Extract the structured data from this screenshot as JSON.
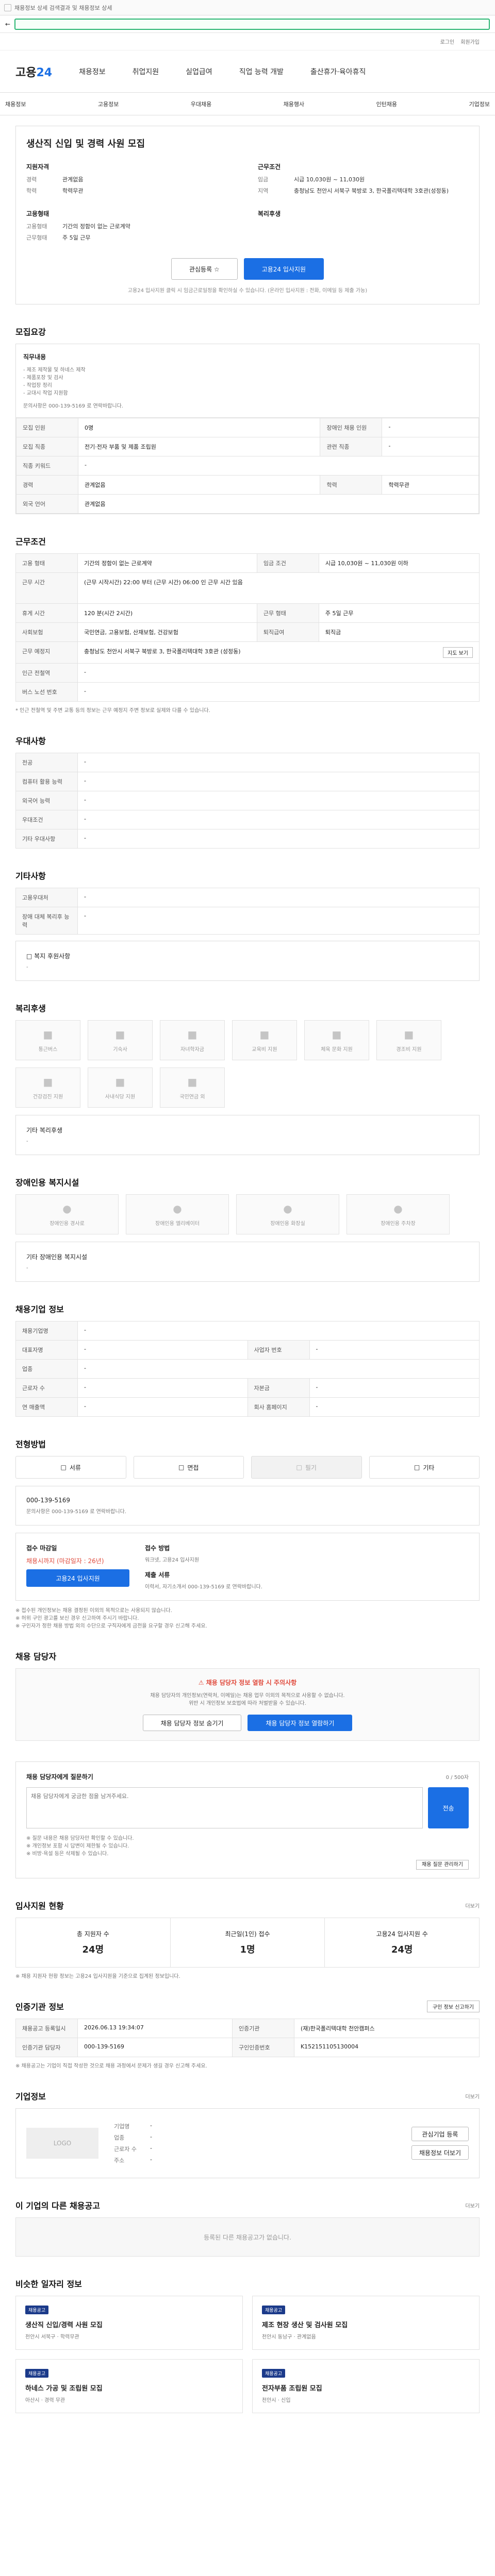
{
  "topbar": {
    "text": "채용정보 상세 검색결과 및 채용정보 상세"
  },
  "util": {
    "login": "로그인",
    "join": "회원가입"
  },
  "logo": {
    "main": "고용",
    "sub": "24"
  },
  "gnb": [
    "채용정보",
    "취업지원",
    "실업급여",
    "직업 능력 개발",
    "출산휴가·육아휴직"
  ],
  "subnav": [
    "채용정보",
    "고용정보",
    "우대채용",
    "채용행사",
    "인턴채용",
    "기업정보"
  ],
  "header": {
    "title": "생산직 신입 및 경력 사원 모집",
    "col1_title": "지원자격",
    "col1": [
      {
        "k": "경력",
        "v": "관계없음"
      },
      {
        "k": "학력",
        "v": "학력무관"
      }
    ],
    "col2_title": "근무조건",
    "col2": [
      {
        "k": "임금",
        "v": "시급 10,030원 ~ 11,030원"
      },
      {
        "k": "지역",
        "v": "충청남도 천안시 서북구 북방로 3, 한국폴리텍대학 3호관(성정동)"
      }
    ],
    "col3_title": "고용형태",
    "col3": [
      {
        "k": "고용형태",
        "v": "기간의 정함이 없는 근로계약"
      },
      {
        "k": "근무형태",
        "v": "주 5일 근무"
      }
    ],
    "col4_title": "복리후생",
    "col4": [],
    "interest": "관심등록 ☆",
    "apply": "고용24 입사지원",
    "note": "고용24 입사지원 클릭 시 임금근로일정을 확인하실 수 있습니다. (온라인 입사지원 : 전화, 이메일 등 제출 가능)"
  },
  "recruit": {
    "title": "모집요강",
    "job_title": "직무내용",
    "job_lines": [
      "- 제조 제작물 및 하네스 제작",
      "- 제품포장 및 검사",
      "- 작업장 정리",
      "- 교대시 작업 지원함"
    ],
    "job_contact": "문의사항은 000-139-5169 로 연락바랍니다.",
    "rows": [
      [
        "모집 인원",
        "0명",
        "장애인 채용 인원",
        "-"
      ],
      [
        "모집 직종",
        "전기·전자 부품 및 제품 조립원",
        "관련 직종",
        "-"
      ],
      [
        "직종 키워드",
        "-",
        "",
        ""
      ],
      [
        "경력",
        "관계없음",
        "학력",
        "학력무관"
      ],
      [
        "외국 언어",
        "관계없음",
        "",
        ""
      ]
    ]
  },
  "conditions": {
    "title": "근무조건",
    "rows": [
      [
        "고용 형태",
        "기간의 정함이 없는 근로계약",
        "임금 조건",
        "시급 10,030원 ~ 11,030원 이하"
      ],
      [
        "근무 시간",
        "(근무 시작시간) 22:00 부터 (근무 시간) 06:00 인 근무 시간 있음",
        "",
        ""
      ],
      [
        "휴게 시간",
        "120 분(시간 2시간)",
        "근무 형태",
        "주 5일 근무"
      ],
      [
        "사회보험",
        "국민연금, 고용보험, 산재보험, 건강보험",
        "퇴직급여",
        "퇴직금"
      ],
      [
        "근무 예정지",
        "충청남도 천안시 서북구 북방로 3, 한국폴리텍대학 3호관 (성정동)",
        "",
        ""
      ],
      [
        "인근 전철역",
        "-",
        "",
        ""
      ],
      [
        "버스 노선 번호",
        "-",
        "",
        ""
      ]
    ],
    "map_btn": "지도 보기",
    "foot": "* 인근 전철역 및 주변 교통 등의 정보는 근무 예정지 주변 정보로 실제와 다를 수 있습니다."
  },
  "preference": {
    "title": "우대사항",
    "rows": [
      [
        "전공",
        "-"
      ],
      [
        "컴퓨터 활용 능력",
        "-"
      ],
      [
        "외국어 능력",
        "-"
      ],
      [
        "우대조건",
        "-"
      ],
      [
        "기타 우대사항",
        "-"
      ]
    ]
  },
  "other": {
    "title": "기타사항",
    "rows": [
      [
        "고용우대처",
        "-"
      ],
      [
        "장애 대체 복리후 능력",
        "-"
      ]
    ],
    "extra": "□ 복지 후원사항",
    "extra_v": "-"
  },
  "welfare": {
    "title": "복리후생",
    "items": [
      "통근버스",
      "기숙사",
      "자녀학자금",
      "교육비 지원",
      "체육 문화 지원",
      "경조비 지원",
      "건강검진 지원",
      "사내식당 지원",
      "국민연금 외"
    ],
    "other_title": "기타 복리후생",
    "other_v": "-"
  },
  "facility": {
    "title": "장애인용 복지시설",
    "items": [
      "장애인용 경사로",
      "장애인용 엘리베이터",
      "장애인용 화장실",
      "장애인용 주차장"
    ],
    "other_title": "기타 장애인용 복지시설",
    "other_v": "-"
  },
  "company": {
    "title": "채용기업 정보",
    "rows": [
      [
        "채용기업명",
        "-",
        "",
        ""
      ],
      [
        "대표자명",
        "-",
        "사업자 번호",
        "-"
      ],
      [
        "업종",
        "-",
        "",
        ""
      ],
      [
        "근로자 수",
        "-",
        "자본금",
        "-"
      ],
      [
        "연 매출액",
        "-",
        "회사 홈페이지",
        "-"
      ]
    ]
  },
  "process": {
    "title": "전형방법",
    "steps": [
      "서류",
      "면접",
      "필기",
      "기타"
    ],
    "contact": "000-139-5169",
    "contact_note": "문의사항은 000-139-5169 로 연락바랍니다.",
    "rows": [
      [
        "접수 마감일",
        "채용시까지 (마감일자 : 26년)",
        "접수 방법",
        "워크넷, 고용24 입사지원"
      ],
      [
        "",
        "",
        "제출 서류",
        "이력서, 자기소개서 000-139-5169 로 연락바랍니다."
      ]
    ],
    "apply": "고용24 입사지원",
    "notes": [
      "※ 접수된 개인정보는 채용 결정된 이외의 목적으로는 사용되지 않습니다.",
      "※ 허위 구인 광고를 보신 경우 신고하여 주시기 바랍니다.",
      "※ 구인자가 정한 채용 방법 외의 수단으로 구직자에게 금전을 요구할 경우 신고해 주세요."
    ]
  },
  "manager": {
    "title": "채용 담당자",
    "alert": "채용 담당자 정보 열람 시 주의사항",
    "desc": "채용 담당자의 개인정보(연락처, 이메일)는 채용 업무 이외의 목적으로 사용할 수 없습니다.",
    "desc2": "위반 시 개인정보 보호법에 따라 처벌받을 수 있습니다.",
    "btn1": "채용 담당자 정보 숨기기",
    "btn2": "채용 담당자 정보 열람하기"
  },
  "inquiry": {
    "title": "채용 담당자에게 질문하기",
    "count": "0 / 500자",
    "placeholder": "채용 담당자에게 궁금한 점을 남겨주세요.",
    "send": "전송",
    "notes": [
      "※ 질문 내용은 채용 담당자만 확인할 수 있습니다.",
      "※ 개인정보 포함 시 답변이 제한될 수 있습니다.",
      "※ 비방·욕설 등은 삭제될 수 있습니다."
    ],
    "faq": "채용 질문 관리하기"
  },
  "stats": {
    "title": "입사지원 현황",
    "more": "더보기",
    "items": [
      {
        "label": "총 지원자 수",
        "n": "24명"
      },
      {
        "label": "최근일(1인) 접수",
        "n": "1명"
      },
      {
        "label": "고용24 입사지원 수",
        "n": "24명"
      }
    ],
    "note": "※ 채용 지원자 현황 정보는 고용24 입사지원을 기준으로 집계된 정보입니다."
  },
  "info": {
    "title": "인증기관 정보",
    "btn": "구인 정보 신고하기",
    "rows": [
      [
        "채용공고 등록일시",
        "2026.06.13 19:34:07",
        "인증기관",
        "(재)한국폴리텍대학 천안캠퍼스"
      ],
      [
        "인증기관 담당자",
        "000-139-5169",
        "구인인증번호",
        "K152151105130004"
      ]
    ],
    "note": "※ 채용공고는 기업이 직접 작성한 것으로 채용 과정에서 문제가 생길 경우 신고해 주세요."
  },
  "biz": {
    "title": "기업정보",
    "more": "더보기",
    "logo": "LOGO",
    "rows": [
      [
        "기업명",
        "-"
      ],
      [
        "업종",
        "-"
      ],
      [
        "근로자 수",
        "-"
      ],
      [
        "주소",
        "-"
      ]
    ],
    "btn1": "관심기업 등록",
    "btn2": "채용정보 더보기"
  },
  "recommend": {
    "title": "이 기업의 다른 채용공고",
    "more": "더보기",
    "empty": "등록된 다른 채용공고가 없습니다."
  },
  "similar": {
    "title": "비슷한 일자리 정보",
    "items": [
      {
        "tag": "채용공고",
        "title": "생산직 신입/경력 사원 모집",
        "meta": "천안시 서북구 · 학력무관"
      },
      {
        "tag": "채용공고",
        "title": "제조 현장 생산 및 검사원 모집",
        "meta": "천안시 동남구 · 관계없음"
      },
      {
        "tag": "채용공고",
        "title": "하네스 가공 및 조립원 모집",
        "meta": "아산시 · 경력 무관"
      },
      {
        "tag": "채용공고",
        "title": "전자부품 조립원 모집",
        "meta": "천안시 · 신입"
      }
    ]
  }
}
